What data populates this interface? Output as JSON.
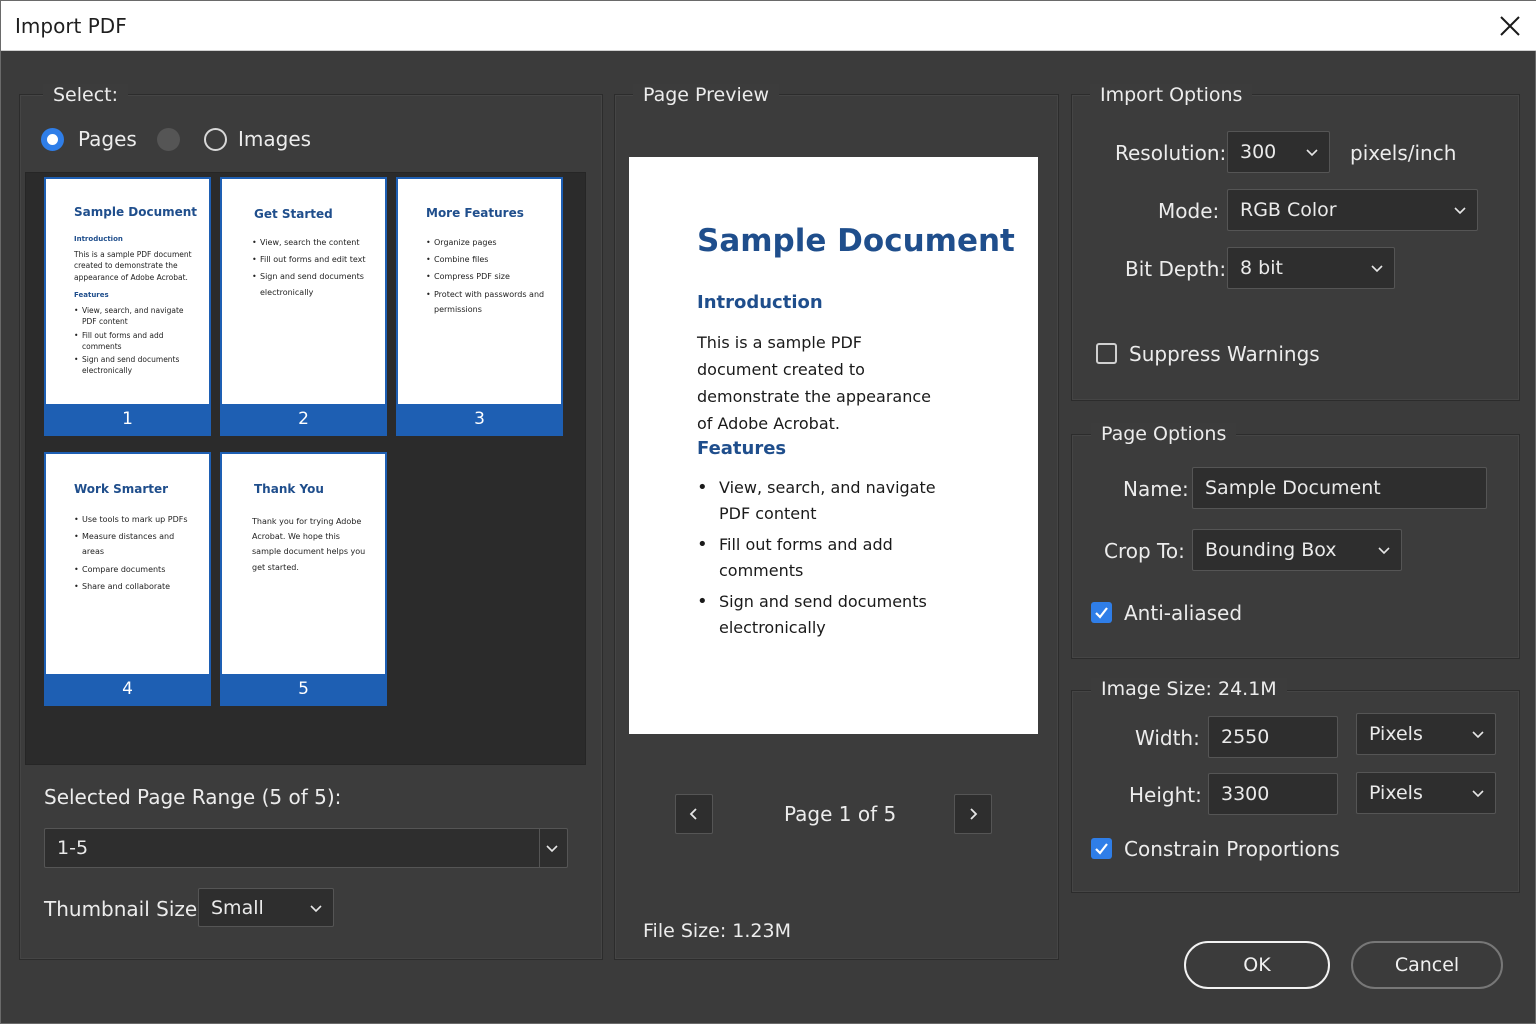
{
  "window": {
    "title": "Import PDF"
  },
  "select": {
    "legend": "Select:",
    "options": [
      "Pages",
      "Images"
    ],
    "selected": "Pages"
  },
  "thumbnails": [
    {
      "page": "1",
      "title": "Sample Document",
      "sub1": "Introduction",
      "text": "This is a sample PDF document created to demonstrate the appearance of Adobe Acrobat.",
      "sub2": "Features",
      "bullets": [
        "View, search, and navigate PDF content",
        "Fill out forms and add comments",
        "Sign and send documents electronically"
      ]
    },
    {
      "page": "2",
      "title": "Get Started",
      "bullets": [
        "View, search the content",
        "Fill out forms and edit text",
        "Sign and send documents electronically"
      ]
    },
    {
      "page": "3",
      "title": "More Features",
      "bullets": [
        "Organize pages",
        "Combine files",
        "Compress PDF size",
        "Protect with passwords and permissions"
      ]
    },
    {
      "page": "4",
      "title": "Work Smarter",
      "bullets": [
        "Use tools to mark up PDFs",
        "Measure distances and areas",
        "Compare documents",
        "Share and collaborate"
      ]
    },
    {
      "page": "5",
      "title": "Thank You",
      "text": "Thank you for trying Adobe Acrobat. We hope this sample document helps you get started."
    }
  ],
  "page_range": {
    "label": "Selected Page Range (5 of 5):",
    "value": "1-5"
  },
  "thumbnail_size": {
    "label": "Thumbnail Size:",
    "value": "Small"
  },
  "preview": {
    "legend": "Page Preview",
    "doc_title": "Sample Document",
    "intro_heading": "Introduction",
    "intro_text": "This is a sample PDF document created to demonstrate the appearance of Adobe Acrobat.",
    "features_heading": "Features",
    "features": [
      "View, search, and navigate PDF content",
      "Fill out forms and add comments",
      "Sign and send documents electronically"
    ],
    "page_indicator": "Page 1 of 5",
    "file_size": "File Size:  1.23M"
  },
  "import_options": {
    "legend": "Import Options",
    "resolution_label": "Resolution:",
    "resolution_value": "300",
    "resolution_unit": "pixels/inch",
    "mode_label": "Mode:",
    "mode_value": "RGB Color",
    "bitdepth_label": "Bit Depth:",
    "bitdepth_value": "8 bit",
    "suppress_label": "Suppress Warnings",
    "suppress_checked": false
  },
  "page_options": {
    "legend": "Page Options",
    "name_label": "Name:",
    "name_value": "Sample Document",
    "crop_label": "Crop To:",
    "crop_value": "Bounding Box",
    "antialiased_label": "Anti-aliased",
    "antialiased_checked": true
  },
  "image_size": {
    "legend": "Image Size:  24.1M",
    "width_label": "Width:",
    "width_value": "2550",
    "width_unit": "Pixels",
    "height_label": "Height:",
    "height_value": "3300",
    "height_unit": "Pixels",
    "constrain_label": "Constrain Proportions",
    "constrain_checked": true
  },
  "buttons": {
    "ok": "OK",
    "cancel": "Cancel"
  },
  "colors": {
    "accent": "#2f7ee8",
    "thumb_bar": "#1e5fb3",
    "doc_heading": "#1f4e8c"
  }
}
